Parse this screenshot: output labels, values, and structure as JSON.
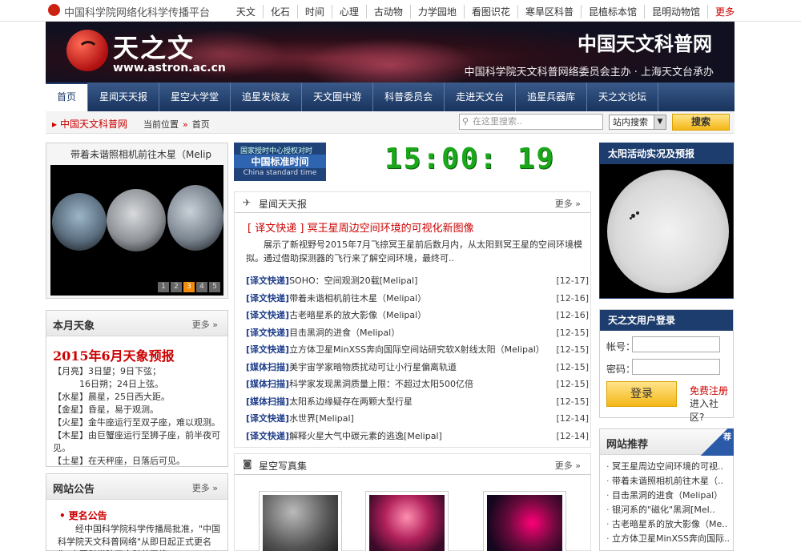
{
  "topbar": {
    "brand": "中国科学院网络化科学传播平台",
    "links": [
      "天文",
      "化石",
      "时间",
      "心理",
      "古动物",
      "力学园地",
      "看图识花",
      "寒旱区科普",
      "昆植标本馆",
      "昆明动物馆"
    ],
    "more": "更多"
  },
  "banner": {
    "logo_text": "天之文",
    "logo_url": "www.astron.ac.cn",
    "title": "中国天文科普网",
    "subtitle": "中国科学院天文科普网络委员会主办 · 上海天文台承办"
  },
  "nav": [
    "首页",
    "星闻天天报",
    "星空大学堂",
    "追星发烧友",
    "天文圈中游",
    "科普委员会",
    "走进天文台",
    "追星兵器库",
    "天之文论坛"
  ],
  "location": {
    "site": "中国天文科普网",
    "current_label": "当前位置",
    "separator": "»",
    "current": "首页"
  },
  "search": {
    "placeholder": "在这里搜索..",
    "scope": "站内搜索",
    "button": "搜索"
  },
  "slider": {
    "caption": "带着未谐照相机前往木星（Melip",
    "pages": [
      "1",
      "2",
      "3",
      "4",
      "5"
    ],
    "active_page": "3"
  },
  "astro": {
    "title": "本月天象",
    "more": "更多 »",
    "headline": "2015年6月天象预报",
    "lines": [
      "【月亮】3日望；9日下弦；",
      "　　　16日朔；24日上弦。",
      "【水星】晨星，25日西大距。",
      "【金星】昏星，易于观测。",
      "【火星】金牛座运行至双子座，难以观测。",
      "【木星】由巨蟹座运行至狮子座，前半夜可见。",
      "【土星】在天秤座，日落后可见。"
    ]
  },
  "notice": {
    "title": "网站公告",
    "more": "更多 »",
    "item_title": "更名公告",
    "item_body": "经中国科学院科学传播局批准，\"中国科学院天文科普网络\"从即日起正式更名为\"中国科学院天文科普网络"
  },
  "clock": {
    "label1": "国家授时中心授权对时",
    "label2": "中国标准时间",
    "label3": "China standard time",
    "time": "15:00: 19"
  },
  "news": {
    "title": "星闻天天报",
    "more": "更多 »",
    "headline_tag": "[ 译文快递 ]",
    "headline": "冥王星周边空间环境的可视化新图像",
    "summary": "展示了新视野号2015年7月飞掠冥王星前后数月内，从太阳到冥王星的空间环境模拟。通过借助探测器的飞行来了解空间环境，最终可..",
    "items": [
      {
        "cat": "[译文快递]",
        "title": "SOHO：空间观测20载[Melipal]",
        "date": "[12-17]"
      },
      {
        "cat": "[译文快递]",
        "title": "带着未谐相机前往木星（Melipal）",
        "date": "[12-16]"
      },
      {
        "cat": "[译文快递]",
        "title": "古老暗星系的放大影像（Melipal）",
        "date": "[12-16]"
      },
      {
        "cat": "[译文快递]",
        "title": "目击黑洞的进食（Melipal）",
        "date": "[12-15]"
      },
      {
        "cat": "[译文快递]",
        "title": "立方体卫星MinXSS奔向国际空间站研究软X射线太阳（Melipal）",
        "date": "[12-15]"
      },
      {
        "cat": "[媒体扫描]",
        "title": "美宇宙学家暗物质扰动可让小行星偏离轨道",
        "date": "[12-15]"
      },
      {
        "cat": "[媒体扫描]",
        "title": "科学家发现黑洞质量上限：不超过太阳500亿倍",
        "date": "[12-15]"
      },
      {
        "cat": "[媒体扫描]",
        "title": "太阳系边缘疑存在两颗大型行星",
        "date": "[12-15]"
      },
      {
        "cat": "[译文快递]",
        "title": "水世界[Melipal]",
        "date": "[12-14]"
      },
      {
        "cat": "[译文快递]",
        "title": "解释火星大气中碳元素的逃逸[Melipal]",
        "date": "[12-14]"
      }
    ]
  },
  "gallery": {
    "title": "星空写真集",
    "more": "更多 »"
  },
  "sun": {
    "title": "太阳活动实况及预报"
  },
  "login": {
    "title": "天之文用户登录",
    "account_label": "帐号：",
    "password_label": "密码：",
    "button": "登录",
    "register": "免费注册",
    "community": "进入社区?"
  },
  "recommend": {
    "title": "网站推荐",
    "badge": "荐",
    "items": [
      "冥王星周边空间环境的可视..",
      "带着未谐照相机前往木星（..",
      "目击黑洞的进食（Melipal）",
      "银河系的\"磁化\"黑洞[Mel..",
      "古老暗星系的放大影像（Me..",
      "立方体卫星MinXSS奔向国际.."
    ]
  },
  "colors": {
    "nav_bg": "#18345e",
    "accent_red": "#c00",
    "clock_green": "#1aa81a",
    "button_yellow": "#f4b716"
  }
}
